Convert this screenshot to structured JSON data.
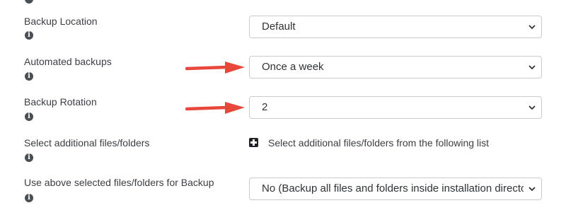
{
  "fields": [
    {
      "label": "Backup Location",
      "value": "Default"
    },
    {
      "label": "Automated backups",
      "value": "Once a week"
    },
    {
      "label": "Backup Rotation",
      "value": "2"
    },
    {
      "label": "Select additional files/folders",
      "link_text": "Select additional files/folders from the following list"
    },
    {
      "label": "Use above selected files/folders for Backup",
      "value": "No (Backup all files and folders inside installation directory)"
    }
  ],
  "info_icon_glyph": "i",
  "icons": {
    "info": "info-circle-icon",
    "add": "plus-square-icon",
    "dropdown": "chevron-down-icon",
    "annotation": "arrow-right-icon"
  },
  "colors": {
    "arrow": "#e8483c",
    "select_border": "#c8ccd0",
    "text": "#3b3f45"
  }
}
